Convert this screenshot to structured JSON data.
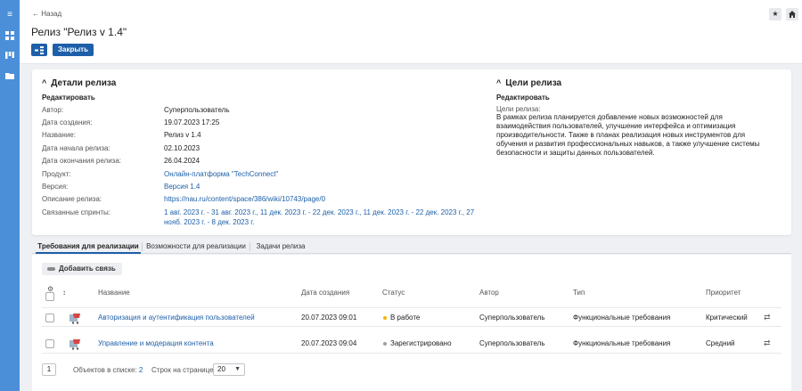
{
  "nav": {
    "back_label": "← Назад",
    "page_title": "Релиз \"Релиз v 1.4\"",
    "close_label": "Закрыть"
  },
  "details": {
    "title": "Детали релиза",
    "edit_label": "Редактировать",
    "fields": [
      {
        "label": "Автор:",
        "value": "Суперпользователь"
      },
      {
        "label": "Дата создания:",
        "value": "19.07.2023 17:25"
      },
      {
        "label": "Название:",
        "value": "Релиз v 1.4"
      },
      {
        "label": "Дата начала релиза:",
        "value": "02.10.2023"
      },
      {
        "label": "Дата окончания релиза:",
        "value": "26.04.2024"
      },
      {
        "label": "Продукт:",
        "value": "Онлайн-платформа \"TechConnect\""
      },
      {
        "label": "Версия:",
        "value": "Версия 1.4"
      },
      {
        "label": "Описание релиза:",
        "value": "https://nau.ru/content/space/386/wiki/10743/page/0"
      },
      {
        "label": "Связанные спринты:",
        "value": "1 авг. 2023 г. - 31 авг. 2023 г., 11 дек. 2023 г. - 22 дек. 2023 г., 11 дек. 2023 г. - 22 дек. 2023 г., 27 нояб. 2023 г. - 8 дек. 2023 г."
      }
    ]
  },
  "goals": {
    "title": "Цели релиза",
    "edit_label": "Редактировать",
    "label": "Цели релиза:",
    "text": "В рамках релиза планируется добавление новых возможностей для взаимодействия пользователей, улучшение интерфейса и оптимизация производительности. Также в планах реализация новых инструментов для обучения и развития профессиональных навыков, а также улучшение системы безопасности и защиты данных пользователей."
  },
  "tabs": [
    {
      "label": "Требования для реализации"
    },
    {
      "label": "Возможности для реализации"
    },
    {
      "label": "Задачи релиза"
    }
  ],
  "table": {
    "add_link_label": "Добавить связь",
    "columns": [
      "Название",
      "Дата создания",
      "Статус",
      "Автор",
      "Тип",
      "Приоритет"
    ],
    "rows": [
      {
        "name": "Авторизация и аутентификация пользователей",
        "created": "20.07.2023 09:01",
        "status": "В работе",
        "status_color": "#f0b400",
        "author": "Суперпользователь",
        "type": "Функциональные требования",
        "priority": "Критический"
      },
      {
        "name": "Управление и модерация контента",
        "created": "20.07.2023 09:04",
        "status": "Зарегистрировано",
        "status_color": "#9aa0a6",
        "author": "Суперпользователь",
        "type": "Функциональные требования",
        "priority": "Средний"
      }
    ]
  },
  "footer": {
    "page": "1",
    "objects_label": "Объектов в списке:",
    "objects_count": "2",
    "rows_label": "Строк на странице:",
    "rows_value": "20"
  },
  "colors": {
    "accent": "#1d5fa8",
    "sidebar": "#4a8fd8"
  }
}
